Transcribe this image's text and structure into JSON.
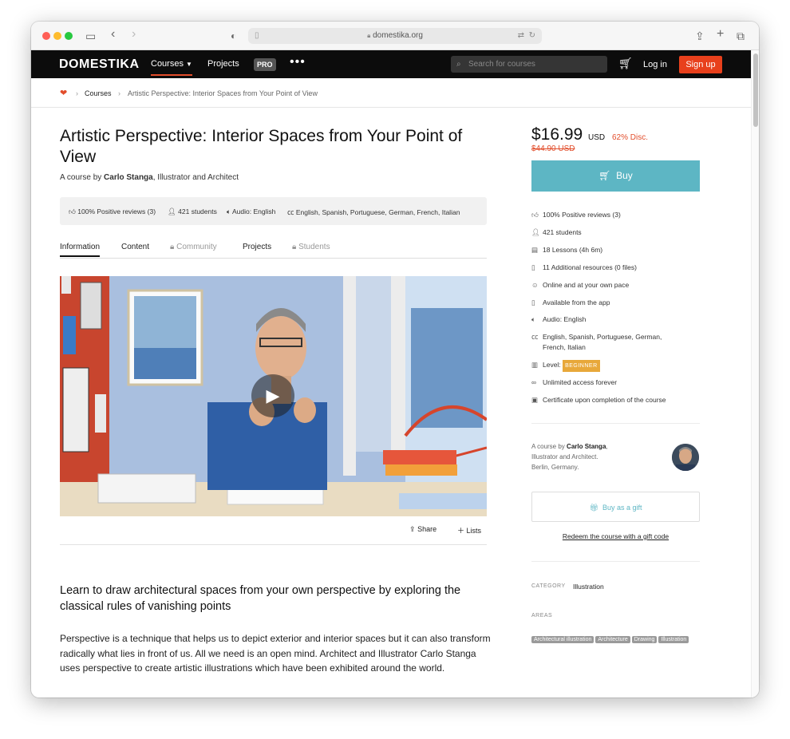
{
  "browser": {
    "url": "domestika.org",
    "traffic_lights": [
      "#ff5f57",
      "#febc2e",
      "#28c840"
    ]
  },
  "nav": {
    "logo": "DOMESTIKA",
    "courses": "Courses",
    "projects": "Projects",
    "pro": "PRO",
    "more": "•••",
    "search_placeholder": "Search for courses",
    "login": "Log in",
    "signup": "Sign up"
  },
  "breadcrumb": {
    "courses": "Courses",
    "current": "Artistic Perspective: Interior Spaces from Your Point of View"
  },
  "course": {
    "title": "Artistic Perspective: Interior Spaces from Your Point of View",
    "byline_prefix": "A course by",
    "author": "Carlo Stanga",
    "byline_suffix": ", Illustrator and Architect",
    "stats": {
      "reviews": "100% Positive reviews (3)",
      "students": "421 students",
      "audio": "Audio: English",
      "subtitles": "English, Spanish, Portuguese, German, French, Italian"
    },
    "tabs": {
      "information": "Information",
      "content": "Content",
      "community": "Community",
      "projects": "Projects",
      "students": "Students"
    },
    "share": "Share",
    "lists": "Lists",
    "subheading": "Learn to draw architectural spaces from your own perspective by exploring the classical rules of vanishing points",
    "description": "Perspective is a technique that helps us to depict exterior and interior spaces but it can also transform radically what lies in front of us. All we need is an open mind. Architect and Illustrator Carlo Stanga uses perspective to create artistic illustrations which have been exhibited around the world."
  },
  "sidebar": {
    "price": "$16.99",
    "currency": "USD",
    "discount": "62% Disc.",
    "old_price": "$44.90 USD",
    "buy": "Buy",
    "features": {
      "reviews": "100% Positive reviews (3)",
      "students": "421 students",
      "lessons": "18 Lessons (4h 6m)",
      "resources": "11 Additional resources (0 files)",
      "pace": "Online and at your own pace",
      "app": "Available from the app",
      "audio": "Audio: English",
      "subtitles": "English, Spanish, Portuguese, German, French, Italian",
      "level_label": "Level:",
      "level": "BEGINNER",
      "access": "Unlimited access forever",
      "certificate": "Certificate upon completion of the course"
    },
    "instructor": {
      "prefix": "A course by",
      "name": "Carlo Stanga",
      "line2": "Illustrator and Architect.",
      "line3": "Berlin, Germany."
    },
    "gift": "Buy as a gift",
    "redeem": "Redeem the course with a gift code",
    "category_label": "CATEGORY",
    "category": "Illustration",
    "areas_label": "AREAS",
    "areas": [
      "Architectural illustration",
      "Architecture",
      "Drawing",
      "Illustration"
    ]
  },
  "colors": {
    "accent": "#e24d2b",
    "buy": "#5db6c4",
    "nav_bg": "#0c0c0c",
    "level_badge": "#e8a83a"
  }
}
